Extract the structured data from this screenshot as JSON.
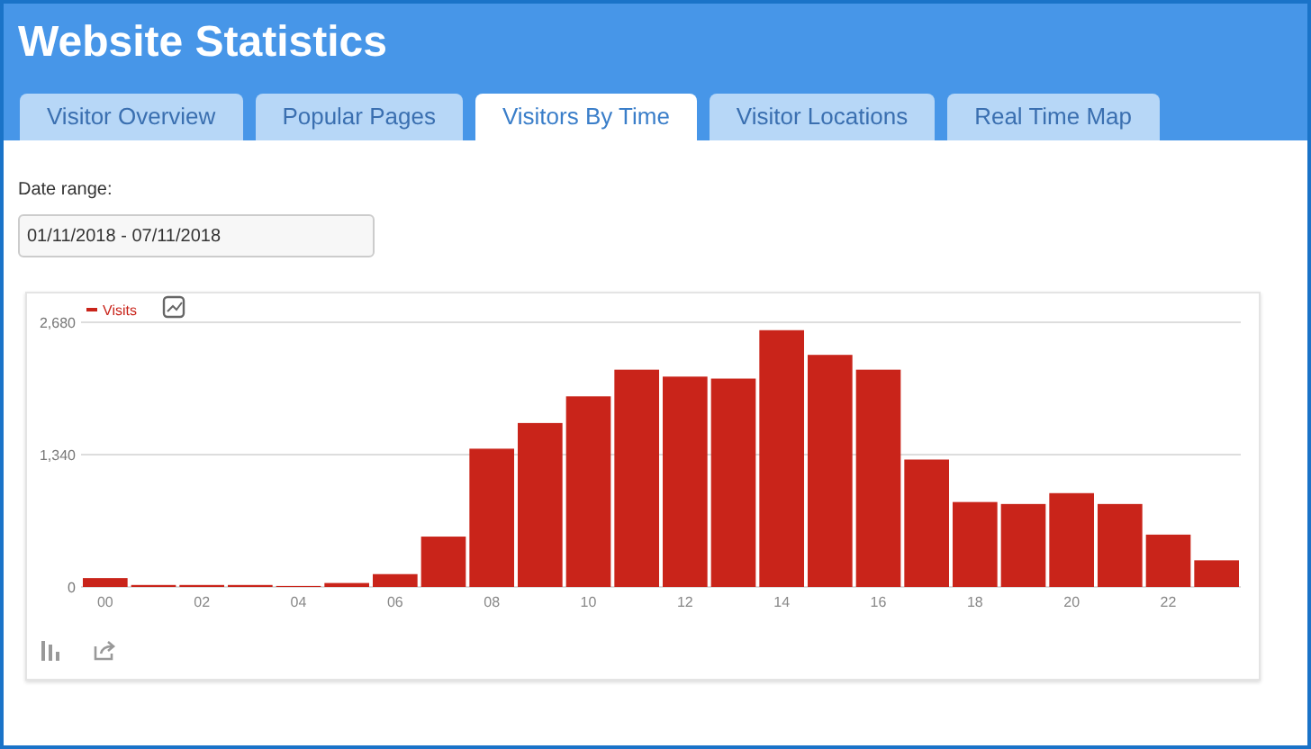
{
  "header": {
    "title": "Website Statistics"
  },
  "tabs": [
    {
      "label": "Visitor Overview",
      "selected": false
    },
    {
      "label": "Popular Pages",
      "selected": false
    },
    {
      "label": "Visitors By Time",
      "selected": true
    },
    {
      "label": "Visitor Locations",
      "selected": false
    },
    {
      "label": "Real Time Map",
      "selected": false
    }
  ],
  "date_range": {
    "label": "Date range:",
    "value": "01/11/2018 - 07/11/2018"
  },
  "chart": {
    "chart_data": {
      "type": "bar",
      "x": [
        0,
        1,
        2,
        3,
        4,
        5,
        6,
        7,
        8,
        9,
        10,
        11,
        12,
        13,
        14,
        15,
        16,
        17,
        18,
        19,
        20,
        21,
        22,
        23
      ],
      "series": [
        {
          "name": "Visits",
          "color": "#c9241a",
          "values": [
            90,
            20,
            20,
            20,
            10,
            40,
            130,
            510,
            1400,
            1660,
            1930,
            2200,
            2130,
            2110,
            2600,
            2350,
            2200,
            1290,
            860,
            840,
            950,
            840,
            530,
            270
          ]
        }
      ],
      "xlim": [
        -0.5,
        23.5
      ],
      "ylim": [
        0,
        2680
      ],
      "yticks": [
        {
          "value": 0,
          "label": "0"
        },
        {
          "value": 1340,
          "label": "1,340"
        },
        {
          "value": 2680,
          "label": "2,680"
        }
      ],
      "xticks": [
        {
          "value": 0,
          "label": "00"
        },
        {
          "value": 2,
          "label": "02"
        },
        {
          "value": 4,
          "label": "04"
        },
        {
          "value": 6,
          "label": "06"
        },
        {
          "value": 8,
          "label": "08"
        },
        {
          "value": 10,
          "label": "10"
        },
        {
          "value": 12,
          "label": "12"
        },
        {
          "value": 14,
          "label": "14"
        },
        {
          "value": 16,
          "label": "16"
        },
        {
          "value": 18,
          "label": "18"
        },
        {
          "value": 20,
          "label": "20"
        },
        {
          "value": 22,
          "label": "22"
        }
      ]
    }
  }
}
